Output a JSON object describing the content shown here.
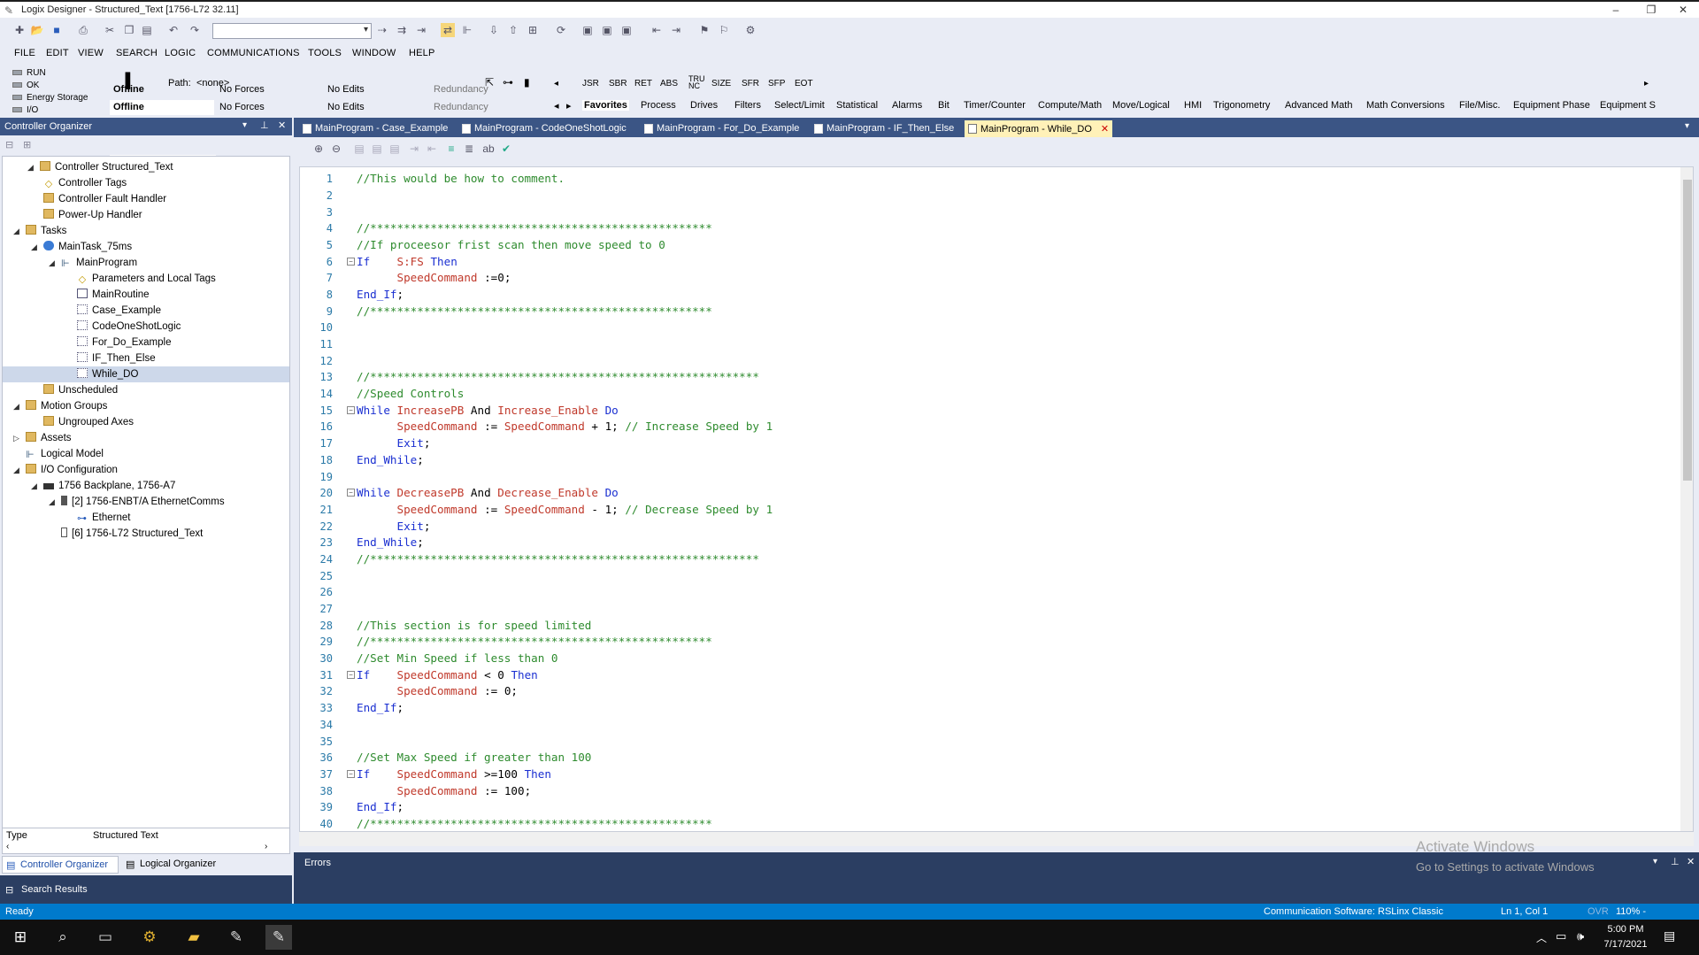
{
  "window": {
    "title": "Logix Designer - Structured_Text [1756-L72 32.11]",
    "min": "–",
    "max": "❐",
    "close": "✕"
  },
  "menu": [
    "FILE",
    "EDIT",
    "VIEW",
    "SEARCH",
    "LOGIC",
    "COMMUNICATIONS",
    "TOOLS",
    "WINDOW",
    "HELP"
  ],
  "status_panel": {
    "run": "RUN",
    "ok": "OK",
    "energy": "Energy Storage",
    "io": "I/O",
    "path_label": "Path:",
    "path_value": "<none>",
    "mode": "Offline",
    "forces": "No Forces",
    "edits": "No Edits",
    "redundancy": "Redundancy"
  },
  "instructions": [
    "JSR",
    "SBR",
    "RET",
    "ABS",
    "TRU\nNC",
    "SIZE",
    "SFR",
    "SFP",
    "EOT"
  ],
  "categories": [
    "Favorites",
    "Process",
    "Drives",
    "Filters",
    "Select/Limit",
    "Statistical",
    "Alarms",
    "Bit",
    "Timer/Counter",
    "Compute/Math",
    "Move/Logical",
    "HMI",
    "Trigonometry",
    "Advanced Math",
    "Math Conversions",
    "File/Misc.",
    "Equipment Phase",
    "Equipment S"
  ],
  "organizer": {
    "title": "Controller Organizer",
    "tree": [
      "Controller Structured_Text",
      "Controller Tags",
      "Controller Fault Handler",
      "Power-Up Handler",
      "Tasks",
      "MainTask_75ms",
      "MainProgram",
      "Parameters and Local Tags",
      "MainRoutine",
      "Case_Example",
      "CodeOneShotLogic",
      "For_Do_Example",
      "IF_Then_Else",
      "While_DO",
      "Unscheduled",
      "Motion Groups",
      "Ungrouped Axes",
      "Assets",
      "Logical Model",
      "I/O Configuration",
      "1756 Backplane, 1756-A7",
      "[2] 1756-ENBT/A EthernetComms",
      "Ethernet",
      "[6] 1756-L72 Structured_Text"
    ],
    "prop_type": "Type",
    "prop_value": "Structured Text",
    "tab_controller": "Controller Organizer",
    "tab_logical": "Logical Organizer",
    "search_results": "Search Results"
  },
  "editor_tabs": [
    "MainProgram - Case_Example",
    "MainProgram - CodeOneShotLogic",
    "MainProgram - For_Do_Example",
    "MainProgram - IF_Then_Else",
    "MainProgram - While_DO"
  ],
  "errors_title": "Errors",
  "watermark": {
    "line1": "Activate Windows",
    "line2": "Go to Settings to activate Windows"
  },
  "statusbar": {
    "ready": "Ready",
    "comm": "Communication Software: RSLinx Classic",
    "pos": "Ln 1, Col 1",
    "ovr": "OVR",
    "zoom": "110% -"
  },
  "clock": {
    "time": "5:00 PM",
    "date": "7/17/2021"
  }
}
